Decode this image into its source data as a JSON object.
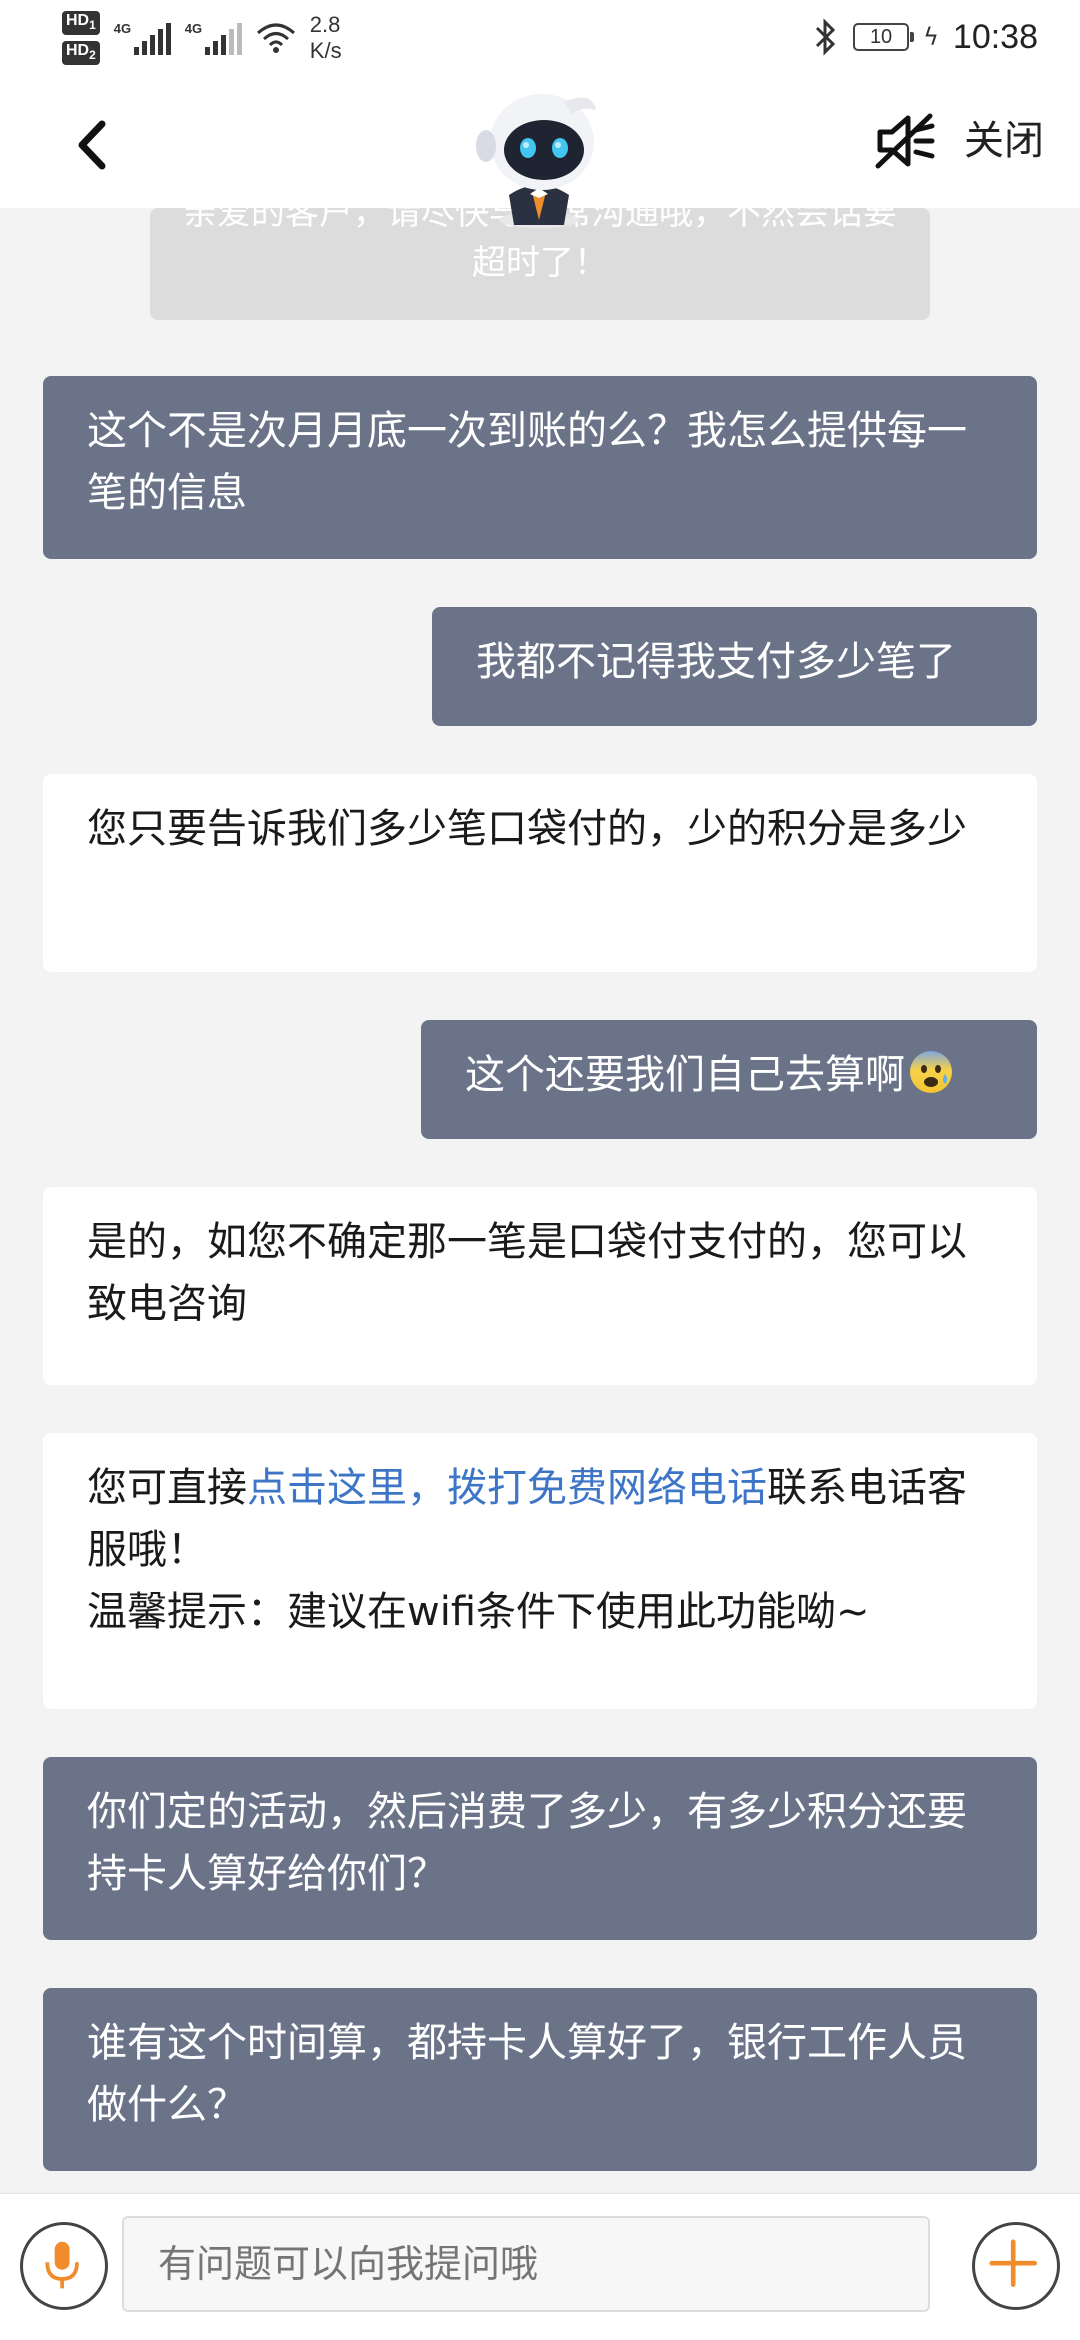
{
  "status_bar": {
    "hd1": "HD",
    "hd1_sub": "1",
    "hd2": "HD",
    "hd2_sub": "2",
    "network1": "4G",
    "network2": "4G",
    "speed_value": "2.8",
    "speed_unit": "K/s",
    "battery": "10",
    "time": "10:38"
  },
  "header": {
    "close_label": "关闭"
  },
  "notice": {
    "text": "亲爱的客户，请尽快与坐席沟通哦，不然会话要超时了！"
  },
  "messages": [
    {
      "side": "out",
      "text": "这个不是次月月底一次到账的么？我怎么提供每一笔的信息"
    },
    {
      "side": "out",
      "text": "我都不记得我支付多少笔了"
    },
    {
      "side": "in",
      "text": "您只要告诉我们多少笔口袋付的，少的积分是多少"
    },
    {
      "side": "out",
      "text": "这个还要我们自己去算啊"
    },
    {
      "side": "in",
      "text": "是的，如您不确定那一笔是口袋付支付的，您可以致电咨询"
    },
    {
      "side": "in",
      "prefix": "您可直接",
      "link": "点击这里，拨打免费网络电话",
      "suffix": "联系电话客服哦！",
      "tip": "温馨提示：建议在wifi条件下使用此功能呦~"
    },
    {
      "side": "out",
      "text": "你们定的活动，然后消费了多少，有多少积分还要持卡人算好给你们？"
    },
    {
      "side": "out",
      "text": "谁有这个时间算，都持卡人算好了，银行工作人员做什么？"
    }
  ],
  "input": {
    "placeholder": "有问题可以向我提问哦"
  },
  "colors": {
    "outgoing_bubble": "#6a7388",
    "incoming_bubble": "#ffffff",
    "link": "#3d75c7",
    "accent_orange": "#f08c2b",
    "background": "#f3f3f3"
  },
  "icons": [
    "back-arrow-icon",
    "robot-avatar-icon",
    "mute-speaker-icon",
    "microphone-icon",
    "plus-icon",
    "bluetooth-icon",
    "wifi-icon",
    "signal-icon",
    "battery-icon",
    "anxious-face-emoji"
  ]
}
